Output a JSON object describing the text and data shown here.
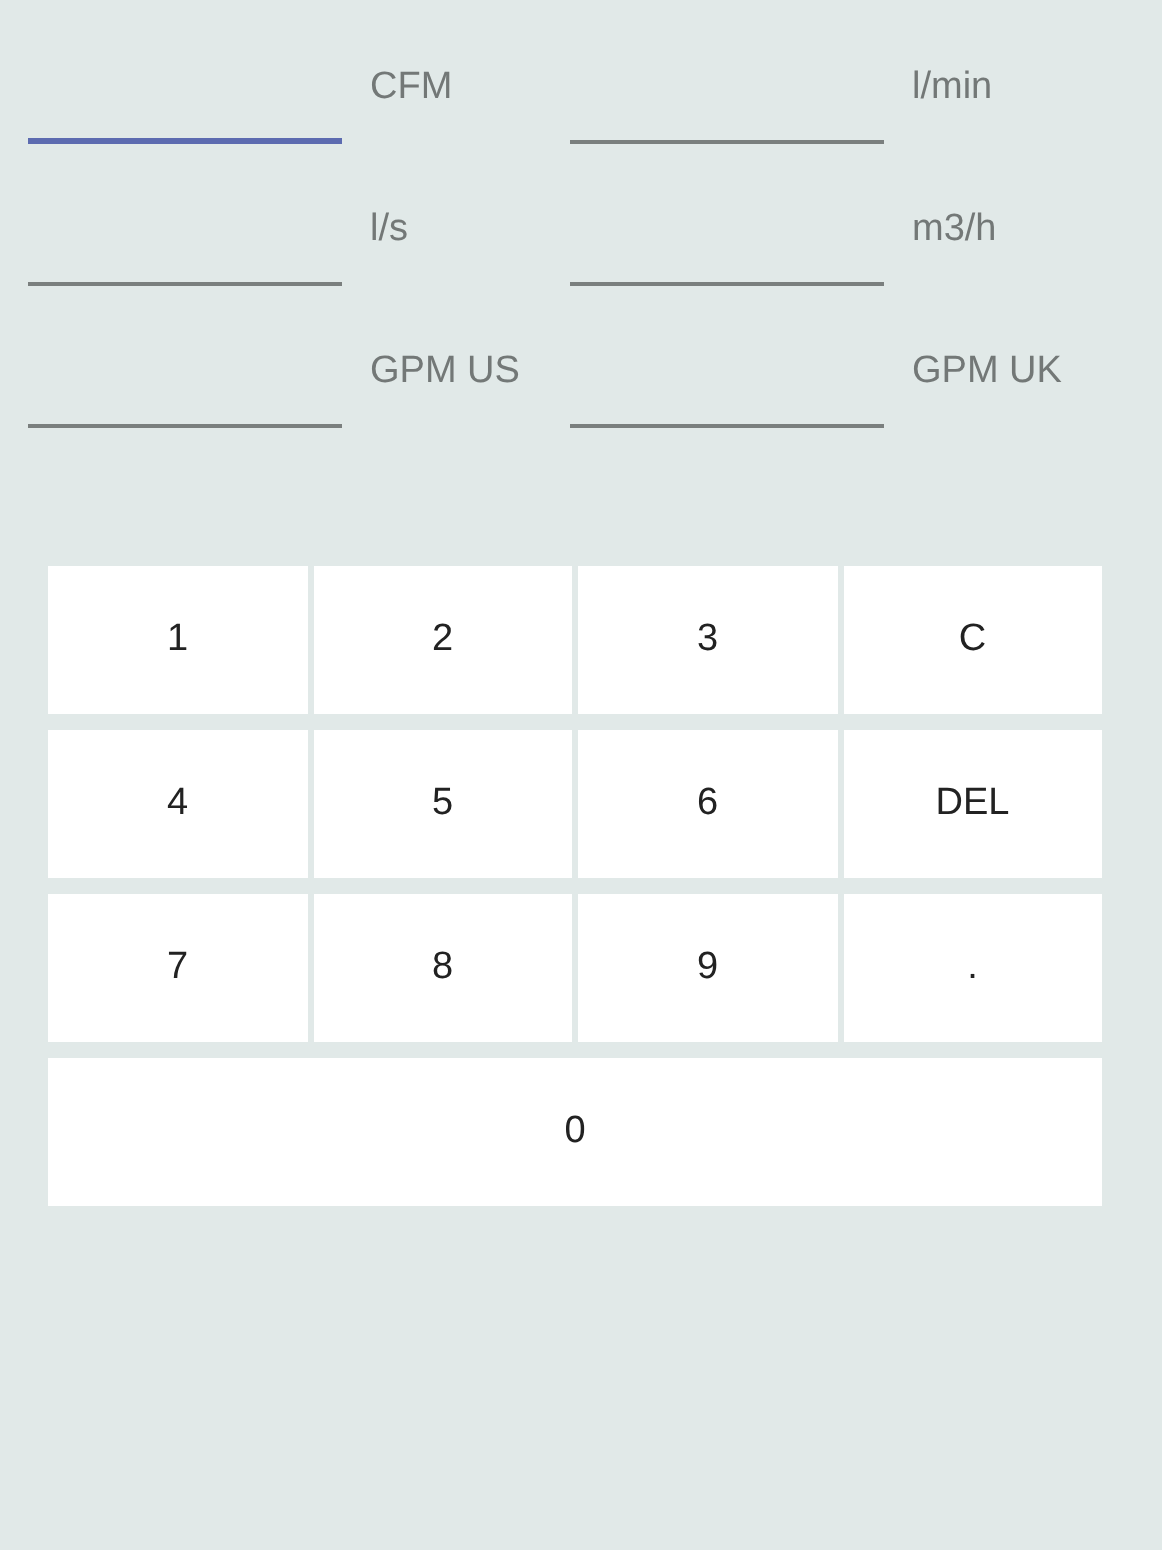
{
  "fields": [
    {
      "unit": "CFM",
      "focused": true
    },
    {
      "unit": "l/min",
      "focused": false
    },
    {
      "unit": "l/s",
      "focused": false
    },
    {
      "unit": "m3/h",
      "focused": false
    },
    {
      "unit": "GPM US",
      "focused": false
    },
    {
      "unit": "GPM UK",
      "focused": false
    }
  ],
  "keypad": {
    "rows": [
      [
        "1",
        "2",
        "3",
        "C"
      ],
      [
        "4",
        "5",
        "6",
        "DEL"
      ],
      [
        "7",
        "8",
        "9",
        "."
      ],
      [
        "0"
      ]
    ]
  }
}
